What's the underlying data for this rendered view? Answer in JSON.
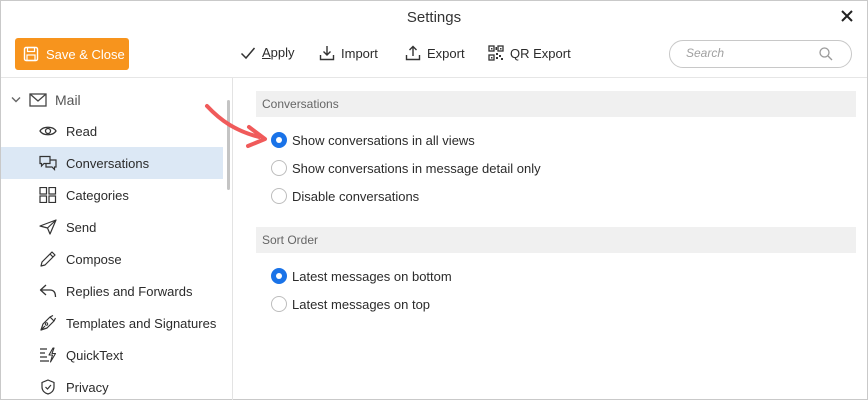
{
  "window": {
    "title": "Settings"
  },
  "toolbar": {
    "save_close_label": "Save & Close",
    "apply_label": "Apply",
    "apply_mnemonic": "A",
    "apply_rest": "pply",
    "import_label": "Import",
    "export_label": "Export",
    "qr_export_label": "QR Export",
    "search_placeholder": "Search"
  },
  "sidebar": {
    "group_label": "Mail",
    "items": [
      {
        "label": "Read",
        "icon": "eye-icon"
      },
      {
        "label": "Conversations",
        "icon": "conversations-icon",
        "active": true
      },
      {
        "label": "Categories",
        "icon": "categories-icon"
      },
      {
        "label": "Send",
        "icon": "send-icon"
      },
      {
        "label": "Compose",
        "icon": "pencil-icon"
      },
      {
        "label": "Replies and Forwards",
        "icon": "reply-icon"
      },
      {
        "label": "Templates and Signatures",
        "icon": "pen-nib-icon"
      },
      {
        "label": "QuickText",
        "icon": "quicktext-icon"
      },
      {
        "label": "Privacy",
        "icon": "shield-icon"
      }
    ]
  },
  "content": {
    "sections": [
      {
        "title": "Conversations",
        "options": [
          {
            "label": "Show conversations in all views",
            "checked": true
          },
          {
            "label": "Show conversations in message detail only",
            "checked": false
          },
          {
            "label": "Disable conversations",
            "checked": false
          }
        ]
      },
      {
        "title": "Sort Order",
        "options": [
          {
            "label": "Latest messages on bottom",
            "checked": true
          },
          {
            "label": "Latest messages on top",
            "checked": false
          }
        ]
      }
    ]
  },
  "colors": {
    "accent_orange": "#f7941d",
    "radio_blue": "#1a73e8",
    "active_bg": "#dce8f5",
    "annotation_arrow": "#f05a5a"
  }
}
